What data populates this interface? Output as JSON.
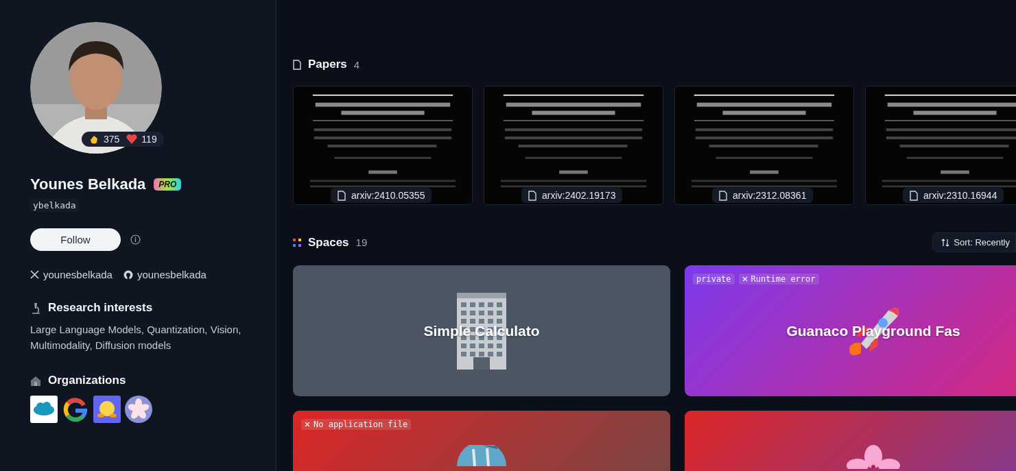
{
  "profile": {
    "name": "Younes Belkada",
    "badge": "PRO",
    "username": "ybelkada",
    "stats": [
      {
        "kind": "clap",
        "value": "375"
      },
      {
        "kind": "heart",
        "value": "119"
      }
    ],
    "follow_button": "Follow",
    "socials": [
      {
        "kind": "x",
        "handle": "younesbelkada"
      },
      {
        "kind": "github",
        "handle": "younesbelkada"
      }
    ],
    "research_interests": {
      "title": "Research interests",
      "text": "Large Language Models, Quantization, Vision, Multimodality, Diffusion models"
    },
    "organizations": {
      "title": "Organizations",
      "items": [
        {
          "kind": "salesforce"
        },
        {
          "kind": "google"
        },
        {
          "kind": "huggingface"
        },
        {
          "kind": "blossom"
        }
      ]
    }
  },
  "papers": {
    "title": "Papers",
    "count": "4",
    "items": [
      {
        "label": "arxiv:2410.05355"
      },
      {
        "label": "arxiv:2402.19173"
      },
      {
        "label": "arxiv:2312.08361"
      },
      {
        "label": "arxiv:2310.16944"
      }
    ]
  },
  "spaces": {
    "title": "Spaces",
    "count": "19",
    "sort": {
      "label": "Sort:",
      "value": "Recently"
    },
    "items": [
      {
        "kind": "building",
        "title": "Simple Calculato"
      },
      {
        "kind": "rocket",
        "title": "Guanaco Playground Fas",
        "tags": [
          {
            "kind": "plain",
            "label": "private"
          },
          {
            "kind": "error",
            "label": "Runtime error"
          }
        ]
      },
      {
        "kind": "bowl",
        "tags": [
          {
            "kind": "error",
            "label": "No application file"
          }
        ]
      },
      {
        "kind": "flower"
      }
    ]
  }
}
